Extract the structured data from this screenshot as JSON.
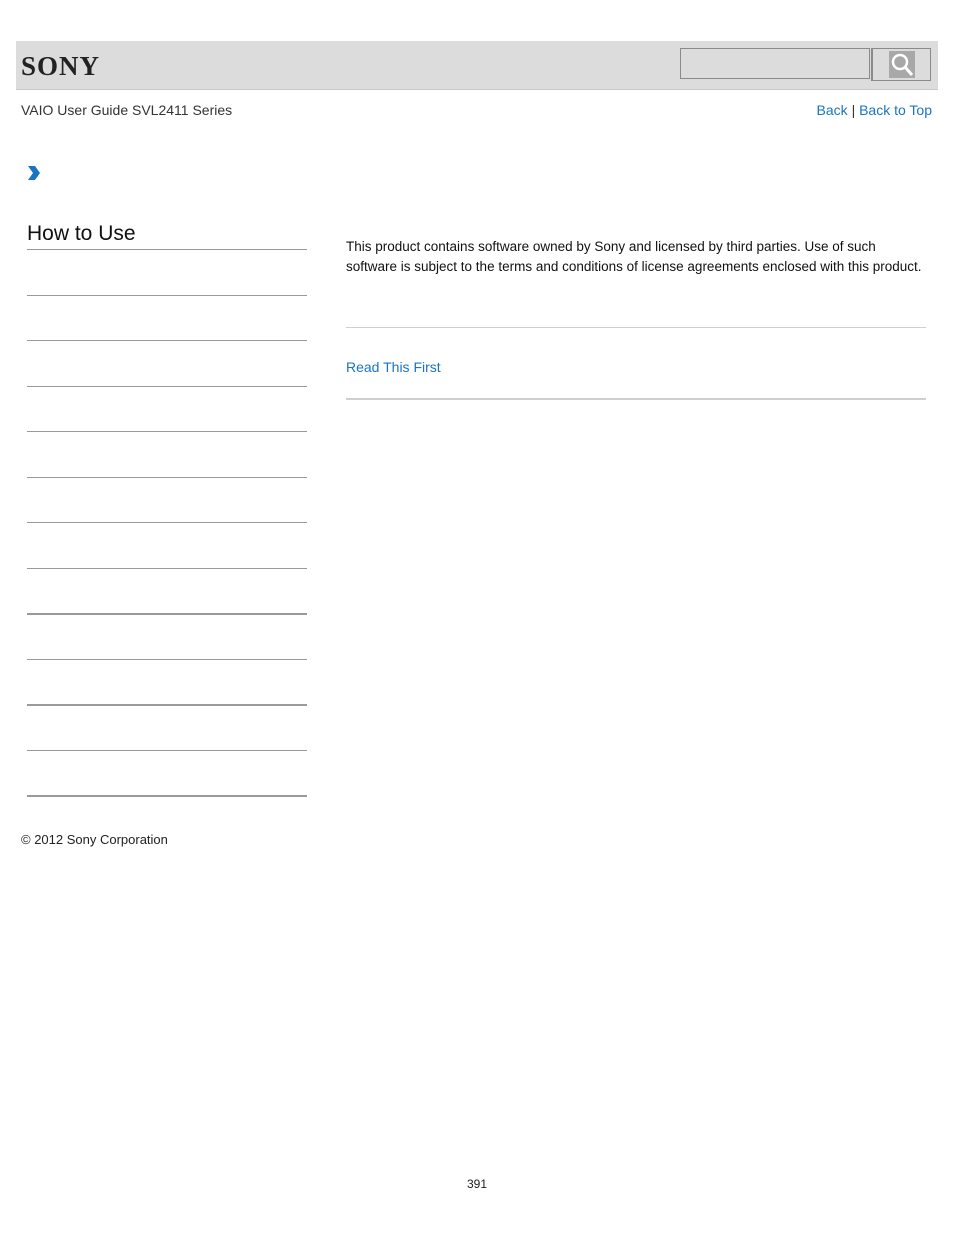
{
  "header": {
    "brand": "SONY",
    "search": {
      "value": "",
      "placeholder": ""
    },
    "search_icon": "magnifier-icon"
  },
  "nav": {
    "subtitle": "VAIO User Guide SVL2411 Series",
    "back_label": "Back",
    "separator": "|",
    "back_to_top_label": "Back to Top",
    "breadcrumb_icon": "chevron-right-icon"
  },
  "sidebar": {
    "title": "How to Use",
    "item_count": 12
  },
  "content": {
    "body": "This product contains software owned by Sony and licensed by third parties. Use of such software is subject to the terms and conditions of license agreements enclosed with this product.",
    "related_link": "Read This First",
    "accent_color": "#1a74c4"
  },
  "footer": {
    "copyright": "© 2012 Sony Corporation",
    "page_number": "391"
  }
}
